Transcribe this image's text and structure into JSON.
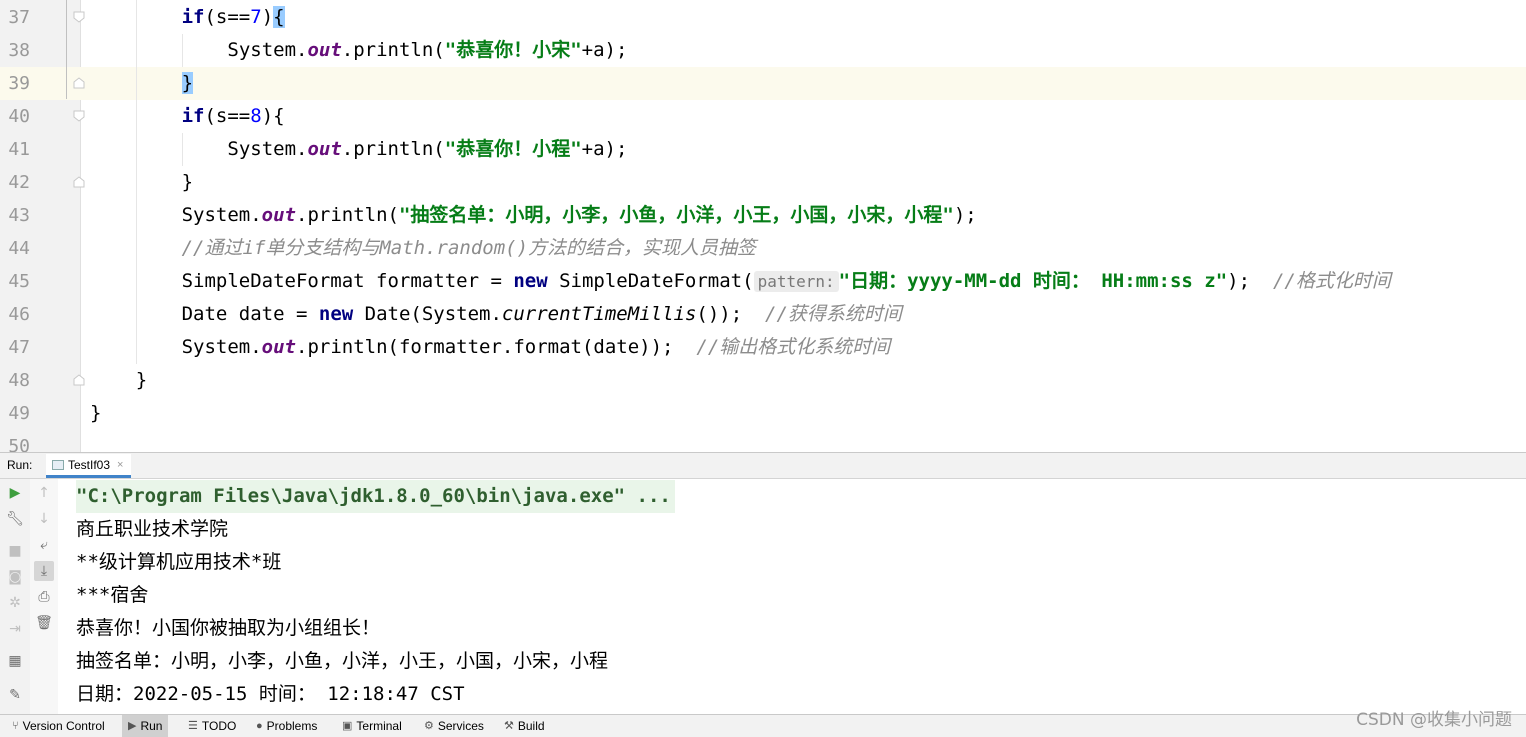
{
  "editor": {
    "lines": [
      {
        "n": "37",
        "indent": 8,
        "tokens": [
          {
            "t": "if",
            "c": "kw"
          },
          {
            "t": "(s=="
          },
          {
            "t": "7",
            "c": "num"
          },
          {
            "t": ")"
          },
          {
            "t": "{",
            "c": "brace-hl"
          }
        ],
        "fold": "open"
      },
      {
        "n": "38",
        "indent": 12,
        "tokens": [
          {
            "t": "System."
          },
          {
            "t": "out",
            "c": "fld"
          },
          {
            "t": ".println("
          },
          {
            "t": "\"恭喜你！小宋\"",
            "c": "str"
          },
          {
            "t": "+a);"
          }
        ]
      },
      {
        "n": "39",
        "indent": 8,
        "tokens": [
          {
            "t": "}",
            "c": "brace-hl"
          }
        ],
        "fold": "close",
        "current": true
      },
      {
        "n": "40",
        "indent": 8,
        "tokens": [
          {
            "t": "if",
            "c": "kw"
          },
          {
            "t": "(s=="
          },
          {
            "t": "8",
            "c": "num"
          },
          {
            "t": "){"
          }
        ],
        "fold": "open"
      },
      {
        "n": "41",
        "indent": 12,
        "tokens": [
          {
            "t": "System."
          },
          {
            "t": "out",
            "c": "fld"
          },
          {
            "t": ".println("
          },
          {
            "t": "\"恭喜你！小程\"",
            "c": "str"
          },
          {
            "t": "+a);"
          }
        ]
      },
      {
        "n": "42",
        "indent": 8,
        "tokens": [
          {
            "t": "}"
          }
        ],
        "fold": "close"
      },
      {
        "n": "43",
        "indent": 8,
        "tokens": [
          {
            "t": "System."
          },
          {
            "t": "out",
            "c": "fld"
          },
          {
            "t": ".println("
          },
          {
            "t": "\"抽签名单：小明，小李，小鱼，小洋，小王，小国，小宋，小程\"",
            "c": "str"
          },
          {
            "t": ");"
          }
        ]
      },
      {
        "n": "44",
        "indent": 8,
        "tokens": [
          {
            "t": "//通过if单分支结构与Math.random()方法的结合，实现人员抽签",
            "c": "cmt"
          }
        ]
      },
      {
        "n": "45",
        "indent": 8,
        "tokens": [
          {
            "t": "SimpleDateFormat formatter = "
          },
          {
            "t": "new",
            "c": "kw"
          },
          {
            "t": " SimpleDateFormat("
          },
          {
            "t": "pattern:",
            "c": "hint"
          },
          {
            "t": "\"日期：yyyy-MM-dd 时间： HH:mm:ss z\"",
            "c": "str"
          },
          {
            "t": ");  "
          },
          {
            "t": "//格式化时间",
            "c": "cmt"
          }
        ]
      },
      {
        "n": "46",
        "indent": 8,
        "tokens": [
          {
            "t": "Date date = "
          },
          {
            "t": "new",
            "c": "kw"
          },
          {
            "t": " Date(System."
          },
          {
            "t": "currentTimeMillis",
            "c": "smeth"
          },
          {
            "t": "());  "
          },
          {
            "t": "//获得系统时间",
            "c": "cmt"
          }
        ]
      },
      {
        "n": "47",
        "indent": 8,
        "tokens": [
          {
            "t": "System."
          },
          {
            "t": "out",
            "c": "fld"
          },
          {
            "t": ".println(formatter.format(date));  "
          },
          {
            "t": "//输出格式化系统时间",
            "c": "cmt"
          }
        ]
      },
      {
        "n": "48",
        "indent": 4,
        "tokens": [
          {
            "t": "}"
          }
        ],
        "fold": "close"
      },
      {
        "n": "49",
        "indent": 0,
        "tokens": [
          {
            "t": "}"
          }
        ]
      },
      {
        "n": "50",
        "indent": 0,
        "tokens": []
      }
    ]
  },
  "run": {
    "label": "Run:",
    "tab": "TestIf03",
    "tab_close": "×",
    "console": [
      {
        "text": "\"C:\\Program Files\\Java\\jdk1.8.0_60\\bin\\java.exe\" ...",
        "cmd": true
      },
      {
        "text": "商丘职业技术学院"
      },
      {
        "text": "**级计算机应用技术*班"
      },
      {
        "text": "***宿舍"
      },
      {
        "text": "恭喜你！小国你被抽取为小组组长！"
      },
      {
        "text": "抽签名单：小明，小李，小鱼，小洋，小王，小国，小宋，小程"
      },
      {
        "text": "日期：2022-05-15 时间： 12:18:47 CST"
      }
    ]
  },
  "bottombar": {
    "items": [
      {
        "label": "Version Control",
        "icon": "⑂",
        "name": "version-control-tab"
      },
      {
        "label": "Run",
        "icon": "▶",
        "name": "run-tab-bottom",
        "active": true
      },
      {
        "label": "TODO",
        "icon": "☰",
        "name": "todo-tab"
      },
      {
        "label": "Problems",
        "icon": "●",
        "name": "problems-tab"
      },
      {
        "label": "Terminal",
        "icon": "▣",
        "name": "terminal-tab"
      },
      {
        "label": "Services",
        "icon": "⚙",
        "name": "services-tab"
      },
      {
        "label": "Build",
        "icon": "⚒",
        "name": "build-tab"
      }
    ]
  },
  "watermark": "CSDN @收集小问题",
  "colors": {
    "keyword": "#000080",
    "string": "#067d17",
    "field": "#660e7a",
    "comment": "#8c8c8c",
    "number": "#0000ff",
    "brace_highlight": "#99ccff",
    "current_line": "#fcfaed"
  }
}
